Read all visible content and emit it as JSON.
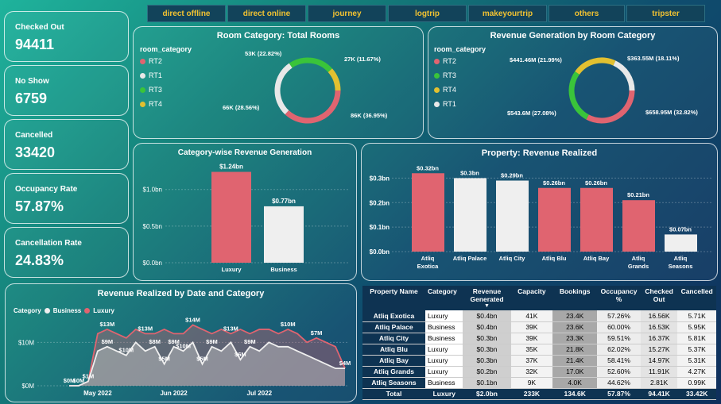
{
  "kpis": [
    {
      "label": "Checked Out",
      "value": "94411"
    },
    {
      "label": "No Show",
      "value": "6759"
    },
    {
      "label": "Cancelled",
      "value": "33420"
    },
    {
      "label": "Occupancy Rate",
      "value": "57.87%"
    },
    {
      "label": "Cancellation Rate",
      "value": "24.83%"
    }
  ],
  "channels": [
    "direct offline",
    "direct online",
    "journey",
    "logtrip",
    "makeyourtrip",
    "others",
    "tripster"
  ],
  "room_totals": {
    "title": "Room Category: Total Rooms",
    "legend_title": "room_category",
    "legend": [
      "RT2",
      "RT1",
      "RT3",
      "RT4"
    ],
    "labels": {
      "rt2": "86K (36.95%)",
      "rt1": "66K (28.56%)",
      "rt3": "53K (22.82%)",
      "rt4": "27K (11.67%)"
    }
  },
  "room_revenue": {
    "title": "Revenue Generation by Room Category",
    "legend_title": "room_category",
    "legend": [
      "RT2",
      "RT3",
      "RT4",
      "RT1"
    ],
    "labels": {
      "rt2": "$658.95M (32.82%)",
      "rt3": "$543.6M (27.08%)",
      "rt4": "$441.46M (21.99%)",
      "rt1": "$363.55M (18.11%)"
    }
  },
  "category_revenue": {
    "title": "Category-wise Revenue Generation",
    "ticks": [
      "$1.0bn",
      "$0.5bn",
      "$0.0bn"
    ],
    "labels": [
      "$1.24bn",
      "$0.77bn"
    ]
  },
  "property_revenue": {
    "title": "Property: Revenue Realized",
    "ticks": [
      "$0.3bn",
      "$0.2bn",
      "$0.1bn",
      "$0.0bn"
    ],
    "labels": [
      "$0.32bn",
      "$0.3bn",
      "$0.29bn",
      "$0.26bn",
      "$0.26bn",
      "$0.21bn",
      "$0.07bn"
    ],
    "names": [
      "Atliq Exotica",
      "Atliq Palace",
      "Atliq City",
      "Atliq Blu",
      "Atliq Bay",
      "Atliq Grands",
      "Atliq Seasons"
    ]
  },
  "trend": {
    "title": "Revenue Realized by Date and Category",
    "legend_title": "Category",
    "legend": [
      "Business",
      "Luxury"
    ],
    "yticks": [
      "$10M",
      "$0M"
    ],
    "xticks": [
      "May 2022",
      "Jun 2022",
      "Jul 2022"
    ],
    "labels": [
      "$0M",
      "$0M",
      "$1M",
      "$13M",
      "$9M",
      "$10M",
      "$13M",
      "$8M",
      "$9M",
      "$10M",
      "$14M",
      "$5M",
      "$5M",
      "$9M",
      "$6M",
      "$13M",
      "$9M",
      "$10M",
      "$7M",
      "$4M"
    ]
  },
  "table": {
    "headers": [
      "Property Name",
      "Category",
      "Revenue Generated",
      "Capacity",
      "Bookings",
      "Occupancy %",
      "Checked Out",
      "Cancelled"
    ],
    "rows": [
      [
        "Atliq Exotica",
        "Luxury",
        "$0.4bn",
        "41K",
        "23.4K",
        "57.26%",
        "16.56K",
        "5.71K"
      ],
      [
        "Atliq Palace",
        "Business",
        "$0.4bn",
        "39K",
        "23.6K",
        "60.00%",
        "16.53K",
        "5.95K"
      ],
      [
        "Atliq City",
        "Business",
        "$0.3bn",
        "39K",
        "23.3K",
        "59.51%",
        "16.37K",
        "5.81K"
      ],
      [
        "Atliq Blu",
        "Luxury",
        "$0.3bn",
        "35K",
        "21.8K",
        "62.02%",
        "15.27K",
        "5.37K"
      ],
      [
        "Atliq Bay",
        "Luxury",
        "$0.3bn",
        "37K",
        "21.4K",
        "58.41%",
        "14.97K",
        "5.31K"
      ],
      [
        "Atliq Grands",
        "Luxury",
        "$0.2bn",
        "32K",
        "17.0K",
        "52.60%",
        "11.91K",
        "4.27K"
      ],
      [
        "Atliq Seasons",
        "Business",
        "$0.1bn",
        "9K",
        "4.0K",
        "44.62%",
        "2.81K",
        "0.99K"
      ]
    ],
    "total": [
      "Total",
      "Luxury",
      "$2.0bn",
      "233K",
      "134.6K",
      "57.87%",
      "94.41K",
      "33.42K"
    ]
  },
  "colors": {
    "rt2": "#e06470",
    "rt1": "#e8e8e8",
    "rt3": "#3ac43a",
    "rt4": "#e2c030",
    "luxury": "#e06470",
    "business": "#efefef"
  },
  "chart_data": [
    {
      "type": "pie",
      "title": "Room Category: Total Rooms",
      "categories": [
        "RT2",
        "RT1",
        "RT3",
        "RT4"
      ],
      "values": [
        86,
        66,
        53,
        27
      ],
      "percent": [
        36.95,
        28.56,
        22.82,
        11.67
      ]
    },
    {
      "type": "pie",
      "title": "Revenue Generation by Room Category",
      "categories": [
        "RT2",
        "RT3",
        "RT4",
        "RT1"
      ],
      "values": [
        658.95,
        543.6,
        441.46,
        363.55
      ],
      "percent": [
        32.82,
        27.08,
        21.99,
        18.11
      ]
    },
    {
      "type": "bar",
      "title": "Category-wise Revenue Generation",
      "categories": [
        "Luxury",
        "Business"
      ],
      "values": [
        1.24,
        0.77
      ],
      "ylim": [
        0,
        1.3
      ]
    },
    {
      "type": "bar",
      "title": "Property: Revenue Realized",
      "categories": [
        "Atliq Exotica",
        "Atliq Palace",
        "Atliq City",
        "Atliq Blu",
        "Atliq Bay",
        "Atliq Grands",
        "Atliq Seasons"
      ],
      "values": [
        0.32,
        0.3,
        0.29,
        0.26,
        0.26,
        0.21,
        0.07
      ],
      "ylim": [
        0,
        0.35
      ]
    },
    {
      "type": "area",
      "title": "Revenue Realized by Date and Category",
      "series": [
        {
          "name": "Luxury",
          "values": [
            0,
            0,
            1,
            12,
            13,
            12,
            11,
            13,
            12,
            12,
            13,
            12,
            12,
            14,
            13,
            12,
            13,
            12,
            13,
            12,
            13,
            13,
            12,
            13,
            12,
            10,
            11,
            10,
            9,
            4
          ]
        },
        {
          "name": "Business",
          "values": [
            0,
            0,
            1,
            8,
            9,
            8,
            7,
            10,
            8,
            9,
            5,
            9,
            8,
            10,
            5,
            9,
            8,
            10,
            6,
            9,
            8,
            10,
            9,
            9,
            8,
            7,
            6,
            5,
            4,
            4
          ]
        }
      ],
      "ylim": [
        0,
        15
      ]
    }
  ]
}
